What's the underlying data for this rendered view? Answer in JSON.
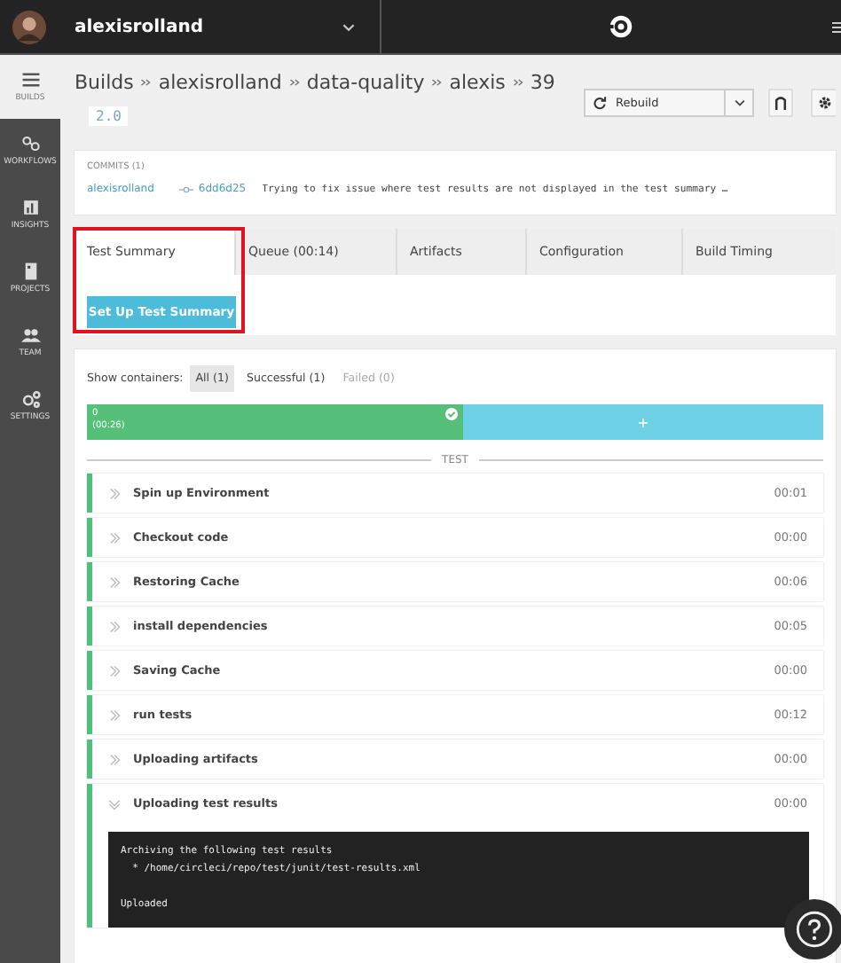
{
  "topbar": {
    "org": "alexisrolland"
  },
  "sidebar": {
    "items": [
      {
        "label": "BUILDS",
        "kind": "builds",
        "selected": true
      },
      {
        "label": "WORKFLOWS",
        "kind": "workflows",
        "selected": false
      },
      {
        "label": "INSIGHTS",
        "kind": "insights",
        "selected": false
      },
      {
        "label": "PROJECTS",
        "kind": "projects",
        "selected": false
      },
      {
        "label": "TEAM",
        "kind": "team",
        "selected": false
      },
      {
        "label": "SETTINGS",
        "kind": "settings",
        "selected": false
      }
    ]
  },
  "breadcrumb": [
    "Builds",
    "alexisrolland",
    "data-quality",
    "alexis",
    "39"
  ],
  "version_tag": "2.0",
  "toolbar": {
    "rebuild": "Rebuild"
  },
  "commits": {
    "title": "COMMITS (1)",
    "items": [
      {
        "author": "alexisrolland",
        "hash": "6dd6d25",
        "message": "Trying to fix issue where test results are not displayed in the test summary …"
      }
    ]
  },
  "tabs": {
    "highlighted": true,
    "items": [
      {
        "label": "Test Summary",
        "selected": true
      },
      {
        "label": "Queue (00:14)",
        "selected": false
      },
      {
        "label": "Artifacts",
        "selected": false
      },
      {
        "label": "Configuration",
        "selected": false
      },
      {
        "label": "Build Timing",
        "selected": false
      }
    ],
    "action": "Set Up Test Summary"
  },
  "containers": {
    "label": "Show containers:",
    "filters": [
      {
        "label": "All (1)",
        "selected": true,
        "disabled": false
      },
      {
        "label": "Successful (1)",
        "selected": false,
        "disabled": false
      },
      {
        "label": "Failed (0)",
        "selected": false,
        "disabled": true
      }
    ],
    "bar": {
      "index": "0",
      "time": "(00:26)",
      "add": "+"
    }
  },
  "section": "TEST",
  "steps": [
    {
      "name": "Spin up Environment",
      "time": "00:01",
      "expanded": false
    },
    {
      "name": "Checkout code",
      "time": "00:00",
      "expanded": false
    },
    {
      "name": "Restoring Cache",
      "time": "00:06",
      "expanded": false
    },
    {
      "name": "install dependencies",
      "time": "00:05",
      "expanded": false
    },
    {
      "name": "Saving Cache",
      "time": "00:00",
      "expanded": false
    },
    {
      "name": "run tests",
      "time": "00:12",
      "expanded": false
    },
    {
      "name": "Uploading artifacts",
      "time": "00:00",
      "expanded": false
    },
    {
      "name": "Uploading test results",
      "time": "00:00",
      "expanded": true,
      "output": [
        [
          "Archiving the following test results",
          "  * /home/circleci/repo/test/junit/test-results.xml"
        ],
        [
          "Uploaded"
        ]
      ]
    }
  ]
}
